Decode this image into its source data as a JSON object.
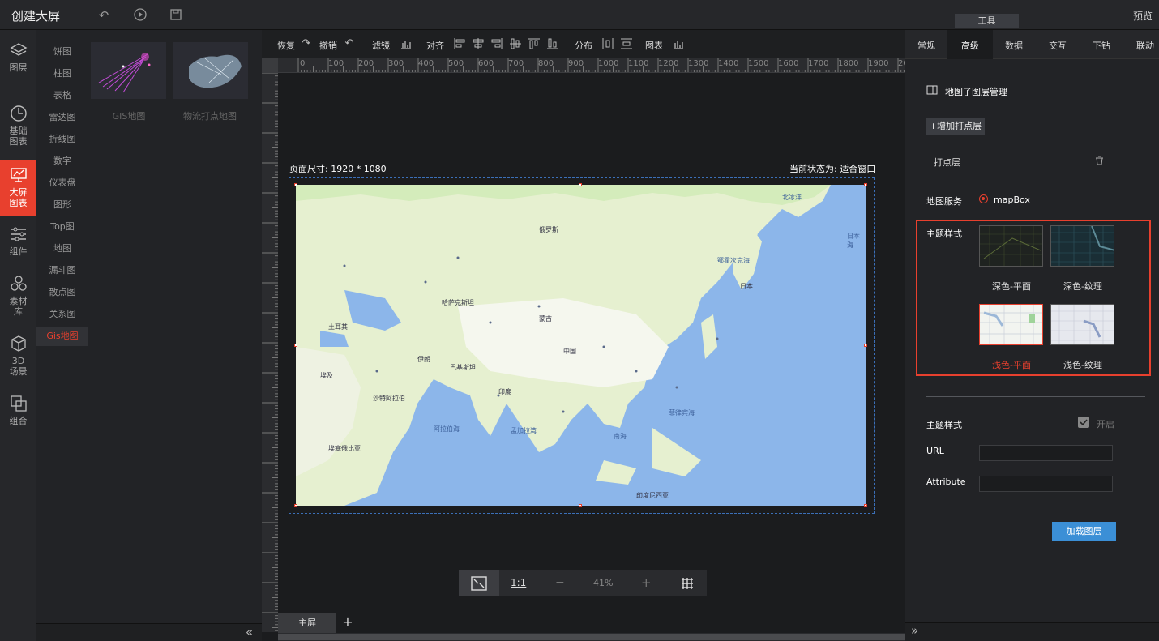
{
  "app": {
    "title": "创建大屏",
    "preview": "预览",
    "tool_tab": "工具"
  },
  "rail": [
    {
      "icon": "layers-icon",
      "label": "图层"
    },
    {
      "icon": "clock-chart-icon",
      "label": "基础\n图表"
    },
    {
      "icon": "screen-chart-icon",
      "label": "大屏\n图表"
    },
    {
      "icon": "sliders-icon",
      "label": "组件"
    },
    {
      "icon": "material-icon",
      "label": "素材\n库"
    },
    {
      "icon": "cube-icon",
      "label": "3D\n场景"
    },
    {
      "icon": "group-icon",
      "label": "组合"
    }
  ],
  "categories": [
    "饼图",
    "柱图",
    "表格",
    "雷达图",
    "折线图",
    "数字",
    "仪表盘",
    "图形",
    "Top图",
    "地图",
    "漏斗图",
    "散点图",
    "关系图",
    "Gis地图"
  ],
  "thumbs": [
    {
      "label": "GIS地图"
    },
    {
      "label": "物流打点地图"
    }
  ],
  "toolbar": {
    "redo": "恢复",
    "undo": "撤销",
    "filter": "滤镜",
    "align": "对齐",
    "distribute": "分布",
    "chart": "图表"
  },
  "ruler_labels": [
    "0",
    "100",
    "200",
    "300",
    "400",
    "500",
    "600",
    "700",
    "800",
    "900",
    "1000",
    "1100",
    "1200",
    "1300",
    "1400",
    "1500",
    "1600",
    "1700",
    "1800",
    "1900",
    "20"
  ],
  "canvas": {
    "size_label": "页面尺寸: 1920 * 1080",
    "state_label": "当前状态为: 适合窗口"
  },
  "zoom": {
    "ratio": "1:1",
    "minus": "−",
    "value": "41%",
    "plus": "+"
  },
  "screen_tabs": {
    "main": "主屏",
    "add": "+"
  },
  "right": {
    "tabs": [
      "常规",
      "高级",
      "数据",
      "交互",
      "下钻",
      "联动"
    ],
    "active_tab": "高级",
    "sublayer_title": "地图子图层管理",
    "add_layer": "+增加打点层",
    "layer_name": "打点层",
    "map_service_label": "地图服务",
    "map_service_value": "mapBox",
    "theme_label": "主题样式",
    "themes": [
      {
        "label": "深色-平面",
        "selected": false
      },
      {
        "label": "深色-纹理",
        "selected": false
      },
      {
        "label": "浅色-平面",
        "selected": true
      },
      {
        "label": "浅色-纹理",
        "selected": false
      }
    ],
    "theme2_label": "主题样式",
    "enable_label": "开启",
    "url_label": "URL",
    "attribute_label": "Attribute",
    "load_button": "加载图层"
  },
  "map_labels": [
    "鄂霍次克海",
    "日本海",
    "北冰洋",
    "阿拉伯海",
    "孟加拉湾",
    "菲律宾海",
    "南海",
    "蒙古",
    "中国",
    "印度",
    "土耳其",
    "沙特阿拉伯",
    "伊朗",
    "哈萨克斯坦",
    "日本",
    "俄罗斯",
    "埃及",
    "埃塞俄比亚",
    "巴基斯坦",
    "印度尼西亚"
  ],
  "colors": {
    "accent": "#e8402e",
    "blue_button": "#3b8fd6"
  }
}
